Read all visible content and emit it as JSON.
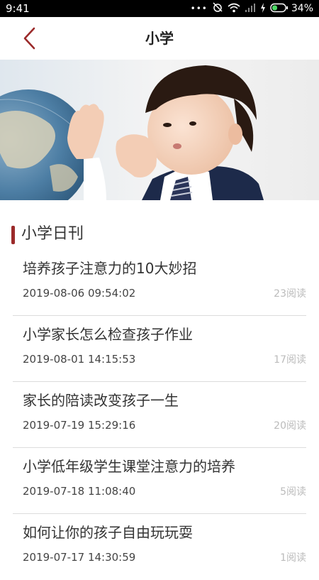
{
  "status_bar": {
    "time": "9:41",
    "battery": "34%"
  },
  "header": {
    "title": "小学"
  },
  "theme": {
    "accent": "#9b2a2a"
  },
  "section": {
    "title": "小学日刊"
  },
  "articles": [
    {
      "title": "培养孩子注意力的10大妙招",
      "date": "2019-08-06 09:54:02",
      "reads": "23阅读"
    },
    {
      "title": "小学家长怎么检查孩子作业",
      "date": "2019-08-01 14:15:53",
      "reads": "17阅读"
    },
    {
      "title": "家长的陪读改变孩子一生",
      "date": "2019-07-19 15:29:16",
      "reads": "20阅读"
    },
    {
      "title": "小学低年级学生课堂注意力的培养",
      "date": "2019-07-18 11:08:40",
      "reads": "5阅读"
    },
    {
      "title": "如何让你的孩子自由玩玩耍",
      "date": "2019-07-17 14:30:59",
      "reads": "1阅读"
    }
  ]
}
